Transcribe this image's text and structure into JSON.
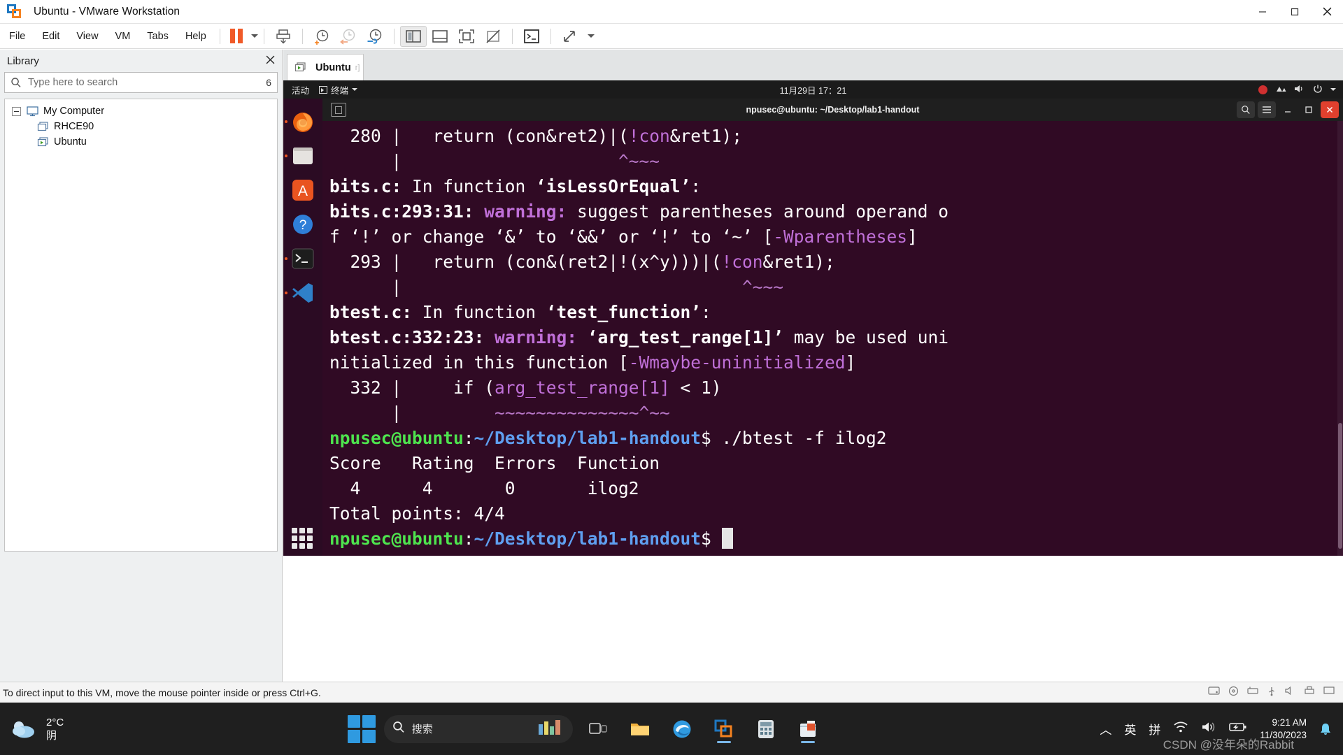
{
  "window": {
    "title": "Ubuntu - VMware Workstation",
    "app_icon": "vmware-logo-icon",
    "controls": {
      "minimize": "minimize-icon",
      "maximize": "maximize-icon",
      "close": "close-icon"
    }
  },
  "menubar": {
    "items": [
      "File",
      "Edit",
      "View",
      "VM",
      "Tabs",
      "Help"
    ],
    "toolbar_icons": [
      "pause-vm-icon",
      "dropdown-caret-icon",
      "send-key-icon",
      "snapshot-take-icon",
      "snapshot-revert-icon",
      "snapshot-manager-icon",
      "show-library-icon",
      "show-thumbnails-icon",
      "full-screen-icon",
      "unity-mode-icon",
      "console-view-icon",
      "stretch-mode-icon"
    ]
  },
  "library": {
    "title": "Library",
    "close_icon": "close-icon",
    "search": {
      "placeholder": "Type here to search",
      "icon": "search-icon",
      "badge": "6"
    },
    "tree": [
      {
        "label": "My Computer",
        "icon": "computer-icon",
        "level": 1,
        "expander": "collapse-icon"
      },
      {
        "label": "RHCE90",
        "icon": "vm-stopped-icon",
        "level": 2
      },
      {
        "label": "Ubuntu",
        "icon": "vm-running-icon",
        "level": 2
      }
    ]
  },
  "tabs": [
    {
      "label": "Ubuntu",
      "icon": "vm-running-icon",
      "mini": "r]",
      "active": true
    }
  ],
  "guest": {
    "gnome_top": {
      "activities": "活动",
      "app_name": "终端",
      "clock": "11月29日 17：21",
      "right_icons": [
        "record-indicator-icon",
        "network-icon",
        "volume-icon",
        "power-icon",
        "chevron-down-icon"
      ]
    },
    "dock": [
      {
        "name": "firefox-icon",
        "color": "#e8600f"
      },
      {
        "name": "files-icon",
        "color": "#d8d4d0"
      },
      {
        "name": "ubuntu-software-icon",
        "color": "#e95420"
      },
      {
        "name": "help-icon",
        "color": "#2f7fd8"
      },
      {
        "name": "terminal-icon",
        "color": "#2b2b2b"
      },
      {
        "name": "vscode-icon",
        "color": "#2f80c8"
      }
    ],
    "show_apps": "show-applications-icon",
    "terminal": {
      "titlebar": {
        "title": "npusec@ubuntu: ~/Desktop/lab1-handout",
        "left_icon": "new-tab-icon",
        "buttons": [
          "search-icon",
          "menu-icon",
          "minimize-icon",
          "maximize-icon",
          "close-icon"
        ]
      },
      "lines": [
        {
          "segments": [
            {
              "t": "  280 |   return (con&ret2)|(",
              "c": "w"
            },
            {
              "t": "!con",
              "c": "mg"
            },
            {
              "t": "&ret1);",
              "c": "w"
            }
          ]
        },
        {
          "segments": [
            {
              "t": "      |                     ",
              "c": "w"
            },
            {
              "t": "^~~~",
              "c": "pk"
            }
          ]
        },
        {
          "segments": [
            {
              "t": "bits.c:",
              "c": "w",
              "b": true
            },
            {
              "t": " In function ",
              "c": "w"
            },
            {
              "t": "‘isLessOrEqual’",
              "c": "w",
              "b": true
            },
            {
              "t": ":",
              "c": "w"
            }
          ]
        },
        {
          "segments": [
            {
              "t": "bits.c:293:31:",
              "c": "w",
              "b": true
            },
            {
              "t": " warning: ",
              "c": "mg",
              "b": true
            },
            {
              "t": "suggest parentheses around operand o",
              "c": "w"
            }
          ]
        },
        {
          "segments": [
            {
              "t": "f ‘!’ or change ‘&’ to ‘&&’ or ‘!’ to ‘~’ ",
              "c": "w"
            },
            {
              "t": "[",
              "c": "w"
            },
            {
              "t": "-Wparentheses",
              "c": "mg"
            },
            {
              "t": "]",
              "c": "w"
            }
          ]
        },
        {
          "segments": [
            {
              "t": "  293 |   return (con&(ret2|!(x^y)))|(",
              "c": "w"
            },
            {
              "t": "!con",
              "c": "mg"
            },
            {
              "t": "&ret1);",
              "c": "w"
            }
          ]
        },
        {
          "segments": [
            {
              "t": "      |                                 ",
              "c": "w"
            },
            {
              "t": "^~~~",
              "c": "pk"
            }
          ]
        },
        {
          "segments": [
            {
              "t": "btest.c:",
              "c": "w",
              "b": true
            },
            {
              "t": " In function ",
              "c": "w"
            },
            {
              "t": "‘test_function’",
              "c": "w",
              "b": true
            },
            {
              "t": ":",
              "c": "w"
            }
          ]
        },
        {
          "segments": [
            {
              "t": "btest.c:332:23:",
              "c": "w",
              "b": true
            },
            {
              "t": " warning: ",
              "c": "mg",
              "b": true
            },
            {
              "t": "‘arg_test_range[1]’",
              "c": "w",
              "b": true
            },
            {
              "t": " may be used uni",
              "c": "w"
            }
          ]
        },
        {
          "segments": [
            {
              "t": "nitialized in this function ",
              "c": "w"
            },
            {
              "t": "[",
              "c": "w"
            },
            {
              "t": "-Wmaybe-uninitialized",
              "c": "mg"
            },
            {
              "t": "]",
              "c": "w"
            }
          ]
        },
        {
          "segments": [
            {
              "t": "  332 |     if (",
              "c": "w"
            },
            {
              "t": "arg_test_range[1]",
              "c": "mg"
            },
            {
              "t": " < 1)",
              "c": "w"
            }
          ]
        },
        {
          "segments": [
            {
              "t": "      |         ",
              "c": "w"
            },
            {
              "t": "~~~~~~~~~~~~~~^~~",
              "c": "pk"
            }
          ]
        },
        {
          "segments": [
            {
              "t": "npusec@ubuntu",
              "c": "g",
              "b": true
            },
            {
              "t": ":",
              "c": "w"
            },
            {
              "t": "~/Desktop/lab1-handout",
              "c": "bl",
              "b": true
            },
            {
              "t": "$ ./btest -f ilog2",
              "c": "w"
            }
          ]
        },
        {
          "segments": [
            {
              "t": "Score   Rating  Errors  Function",
              "c": "w"
            }
          ]
        },
        {
          "segments": [
            {
              "t": "  4      4       0       ilog2",
              "c": "w"
            }
          ]
        },
        {
          "segments": [
            {
              "t": "Total points: 4/4",
              "c": "w"
            }
          ]
        },
        {
          "segments": [
            {
              "t": "npusec@ubuntu",
              "c": "g",
              "b": true
            },
            {
              "t": ":",
              "c": "w"
            },
            {
              "t": "~/Desktop/lab1-handout",
              "c": "bl",
              "b": true
            },
            {
              "t": "$ ",
              "c": "w"
            }
          ],
          "cursor": true
        }
      ]
    }
  },
  "vm_status": {
    "message": "To direct input to this VM, move the mouse pointer inside or press Ctrl+G.",
    "icons": [
      "hard-disk-icon",
      "cd-dvd-icon",
      "network-adapter-icon",
      "usb-icon",
      "sound-card-icon",
      "printer-icon",
      "display-icon"
    ]
  },
  "taskbar": {
    "weather": {
      "icon": "cloud-icon",
      "temp": "2°C",
      "condition": "阴"
    },
    "start": "start-button-icon",
    "search": {
      "placeholder": "搜索",
      "icon": "search-icon",
      "widget_icon": "weather-widget-icon"
    },
    "apps": [
      {
        "name": "task-view-icon"
      },
      {
        "name": "file-explorer-icon"
      },
      {
        "name": "edge-icon"
      },
      {
        "name": "vmware-workstation-icon",
        "active": true
      },
      {
        "name": "calculator-icon"
      },
      {
        "name": "store-icon",
        "active": true
      }
    ],
    "tray": {
      "chevron": "chevron-up-icon",
      "ime_lang": "英",
      "ime_mode": "拼",
      "network": "wifi-icon",
      "volume": "volume-icon",
      "battery": "battery-charging-icon",
      "time": "9:21 AM",
      "date": "11/30/2023",
      "notification": "bell-icon"
    },
    "watermark": "CSDN @没年朵的Rabbit"
  }
}
